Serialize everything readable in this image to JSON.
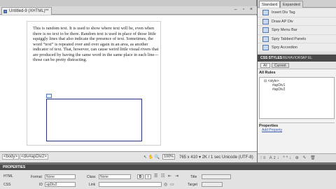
{
  "document": {
    "tab_label": "Untitled-9 (XHTML)*",
    "close_glyph": "×",
    "window_controls": "– ▫ ×",
    "body_text": "This is random text.  It is used to show where text will be, even when there is no text to be there.  Random text is used in place of those little squiggly lines that also indicate the presence of text.  Sometimes, the word “text” is repeated over and over again in an area, as another indicator of text.  That, however, can cause weird little visual rivers that are produced by having the same word in the same place in each line—those can be pretty distracting.",
    "ap_marker": "▫"
  },
  "status_bar": {
    "tag_path": [
      "<body>",
      "<div#apDiv2>"
    ],
    "tools": "↖ ✋ 🔍",
    "zoom": "100%",
    "window_size": "765 x 410 ▾  2K / 1 sec  Unicode (UTF-8)"
  },
  "insert_panel": {
    "tabs": [
      "Standard",
      "Expanded"
    ],
    "items": [
      "Insert Div Tag",
      "Draw AP Div",
      "Spry Menu Bar",
      "Spry Tabbed Panels",
      "Spry Accordion"
    ]
  },
  "css_panel": {
    "tabs": [
      "CSS STYLES",
      "BEHAVIORS",
      "AP EL"
    ],
    "modes": [
      "All",
      "Current"
    ],
    "all_rules_header": "All Rules",
    "rules": [
      "⊟ <style>",
      "#apDiv1",
      "#apDiv2"
    ],
    "properties_header": "Properties",
    "add_property": "Add Property",
    "footer_icons": "⁝≡ Az↓ **↓  ⊕ ✎ 🗑"
  },
  "properties_inspector": {
    "title": "PROPERTIES",
    "html_label": "HTML",
    "css_label": "CSS",
    "format_label": "Format",
    "format_value": "None",
    "class_label": "Class",
    "class_value": "None",
    "id_label": "ID",
    "id_value": "apDiv2",
    "link_label": "Link",
    "link_value": "",
    "title_label": "Title",
    "target_label": "Target",
    "bold": "B",
    "italic": "I"
  },
  "colors": {
    "ap_div_border": "#26327a",
    "panel_dark": "#4a4a4a",
    "insert_icon": "#c7d8f3"
  }
}
